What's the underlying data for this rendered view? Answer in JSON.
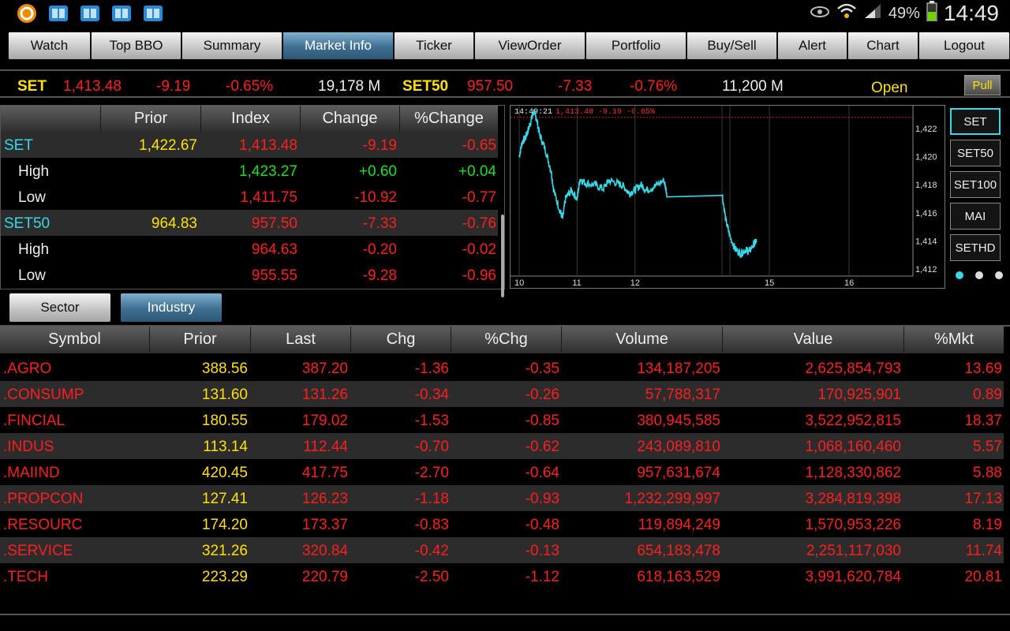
{
  "status_bar": {
    "battery": "49%",
    "time": "14:49"
  },
  "nav": {
    "tabs": [
      "Watch",
      "Top BBO",
      "Summary",
      "Market Info",
      "Ticker",
      "ViewOrder",
      "Portfolio",
      "Buy/Sell",
      "Alert",
      "Chart",
      "Logout"
    ],
    "active": "Market Info"
  },
  "ticker": {
    "set_name": "SET",
    "set_value": "1,413.48",
    "set_change": "-9.19",
    "set_pct": "-0.65%",
    "set_volume": "19,178 M",
    "set50_name": "SET50",
    "set50_value": "957.50",
    "set50_change": "-7.33",
    "set50_pct": "-0.76%",
    "set50_volume": "11,200 M",
    "market_status": "Open",
    "pull_label": "Pull"
  },
  "index_table": {
    "headers": [
      "Prior",
      "Index",
      "Change",
      "%Change"
    ],
    "rows": [
      {
        "label": "SET",
        "prior": "1,422.67",
        "index": "1,413.48",
        "change": "-9.19",
        "pct": "-0.65"
      },
      {
        "label": "High",
        "prior": "",
        "index": "1,423.27",
        "change": "+0.60",
        "pct": "+0.04"
      },
      {
        "label": "Low",
        "prior": "",
        "index": "1,411.75",
        "change": "-10.92",
        "pct": "-0.77"
      },
      {
        "label": "SET50",
        "prior": "964.83",
        "index": "957.50",
        "change": "-7.33",
        "pct": "-0.76"
      },
      {
        "label": "High",
        "prior": "",
        "index": "964.63",
        "change": "-0.20",
        "pct": "-0.02"
      },
      {
        "label": "Low",
        "prior": "",
        "index": "955.55",
        "change": "-9.28",
        "pct": "-0.96"
      }
    ]
  },
  "chart_data": {
    "type": "line",
    "annotation_time": "14:49:21",
    "annotation_value": "1,413.48 -9.19 -0.65%",
    "x_ticks": [
      "10",
      "11",
      "12",
      "15",
      "16"
    ],
    "y_ticks": [
      "1,422",
      "1,420",
      "1,418",
      "1,416",
      "1,414",
      "1,412"
    ],
    "ylim": [
      1411.5,
      1423.5
    ],
    "prior_close": 1422.67,
    "series": [
      {
        "values": [
          [
            10.0,
            1420.0
          ],
          [
            10.05,
            1421.0
          ],
          [
            10.1,
            1421.3
          ],
          [
            10.15,
            1421.8
          ],
          [
            10.2,
            1422.5
          ],
          [
            10.25,
            1423.2
          ],
          [
            10.3,
            1422.7
          ],
          [
            10.35,
            1421.6
          ],
          [
            10.45,
            1420.5
          ],
          [
            10.55,
            1419.0
          ],
          [
            10.6,
            1417.5
          ],
          [
            10.7,
            1416.2
          ],
          [
            10.75,
            1415.6
          ],
          [
            10.8,
            1417.0
          ],
          [
            10.9,
            1417.6
          ],
          [
            11.0,
            1417.0
          ],
          [
            11.05,
            1418.4
          ],
          [
            11.15,
            1418.1
          ],
          [
            11.3,
            1418.0
          ],
          [
            11.45,
            1417.7
          ],
          [
            11.55,
            1418.3
          ],
          [
            11.7,
            1418.1
          ],
          [
            11.8,
            1417.9
          ],
          [
            11.9,
            1417.4
          ],
          [
            12.0,
            1417.6
          ],
          [
            12.1,
            1418.0
          ],
          [
            12.2,
            1417.6
          ],
          [
            12.35,
            1417.9
          ],
          [
            12.5,
            1418.3
          ],
          [
            12.55,
            1417.4
          ],
          [
            12.62,
            1415.5
          ],
          [
            12.7,
            1414.3
          ],
          [
            12.8,
            1413.4
          ],
          [
            12.9,
            1413.1
          ],
          [
            13.0,
            1413.4
          ],
          [
            13.05,
            1413.2
          ],
          [
            13.15,
            1413.8
          ],
          [
            13.2,
            1414.0
          ]
        ]
      }
    ]
  },
  "index_buttons": [
    "SET",
    "SET50",
    "SET100",
    "MAI",
    "SETHD"
  ],
  "sub_tabs": {
    "sector": "Sector",
    "industry": "Industry"
  },
  "main_table": {
    "headers": [
      "Symbol",
      "Prior",
      "Last",
      "Chg",
      "%Chg",
      "Volume",
      "Value",
      "%Mkt"
    ],
    "rows": [
      {
        "symbol": ".AGRO",
        "prior": "388.56",
        "last": "387.20",
        "chg": "-1.36",
        "pct": "-0.35",
        "volume": "134,187,205",
        "value": "2,625,854,793",
        "mkt": "13.69"
      },
      {
        "symbol": ".CONSUMP",
        "prior": "131.60",
        "last": "131.26",
        "chg": "-0.34",
        "pct": "-0.26",
        "volume": "57,788,317",
        "value": "170,925,901",
        "mkt": "0.89"
      },
      {
        "symbol": ".FINCIAL",
        "prior": "180.55",
        "last": "179.02",
        "chg": "-1.53",
        "pct": "-0.85",
        "volume": "380,945,585",
        "value": "3,522,952,815",
        "mkt": "18.37"
      },
      {
        "symbol": ".INDUS",
        "prior": "113.14",
        "last": "112.44",
        "chg": "-0.70",
        "pct": "-0.62",
        "volume": "243,089,810",
        "value": "1,068,160,460",
        "mkt": "5.57"
      },
      {
        "symbol": ".MAIIND",
        "prior": "420.45",
        "last": "417.75",
        "chg": "-2.70",
        "pct": "-0.64",
        "volume": "957,631,674",
        "value": "1,128,330,862",
        "mkt": "5.88"
      },
      {
        "symbol": ".PROPCON",
        "prior": "127.41",
        "last": "126.23",
        "chg": "-1.18",
        "pct": "-0.93",
        "volume": "1,232,299,997",
        "value": "3,284,819,398",
        "mkt": "17.13"
      },
      {
        "symbol": ".RESOURC",
        "prior": "174.20",
        "last": "173.37",
        "chg": "-0.83",
        "pct": "-0.48",
        "volume": "119,894,249",
        "value": "1,570,953,226",
        "mkt": "8.19"
      },
      {
        "symbol": ".SERVICE",
        "prior": "321.26",
        "last": "320.84",
        "chg": "-0.42",
        "pct": "-0.13",
        "volume": "654,183,478",
        "value": "2,251,117,030",
        "mkt": "11.74"
      },
      {
        "symbol": ".TECH",
        "prior": "223.29",
        "last": "220.79",
        "chg": "-2.50",
        "pct": "-1.12",
        "volume": "618,163,529",
        "value": "3,991,620,784",
        "mkt": "20.81"
      }
    ]
  }
}
